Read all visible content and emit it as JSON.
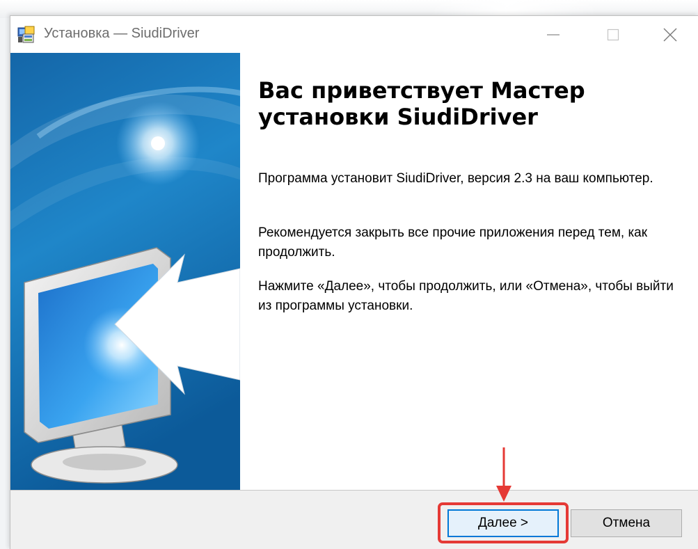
{
  "window": {
    "title": "Установка — SiudiDriver",
    "app_icon": "installer-icon",
    "controls": {
      "minimize_icon": "minimize-icon",
      "maximize_icon": "maximize-icon",
      "close_icon": "close-icon"
    }
  },
  "wizard": {
    "heading": "Вас приветствует Мастер установки SiudiDriver",
    "paragraphs": [
      "Программа установит SiudiDriver, версия 2.3 на ваш компьютер.",
      "Рекомендуется закрыть все прочие приложения перед тем, как продолжить.",
      "Нажмите «Далее», чтобы продолжить, или «Отмена», чтобы выйти из программы установки."
    ],
    "image": "monitor-wizard-graphic"
  },
  "buttons": {
    "next_label": "Далее >",
    "cancel_label": "Отмена"
  },
  "annotation": {
    "highlight_color": "#e53935",
    "arrow_icon": "down-arrow-icon"
  },
  "colors": {
    "accent": "#0078d7",
    "button_face": "#e1e1e1",
    "bottom_bar": "#f0f0f0"
  }
}
